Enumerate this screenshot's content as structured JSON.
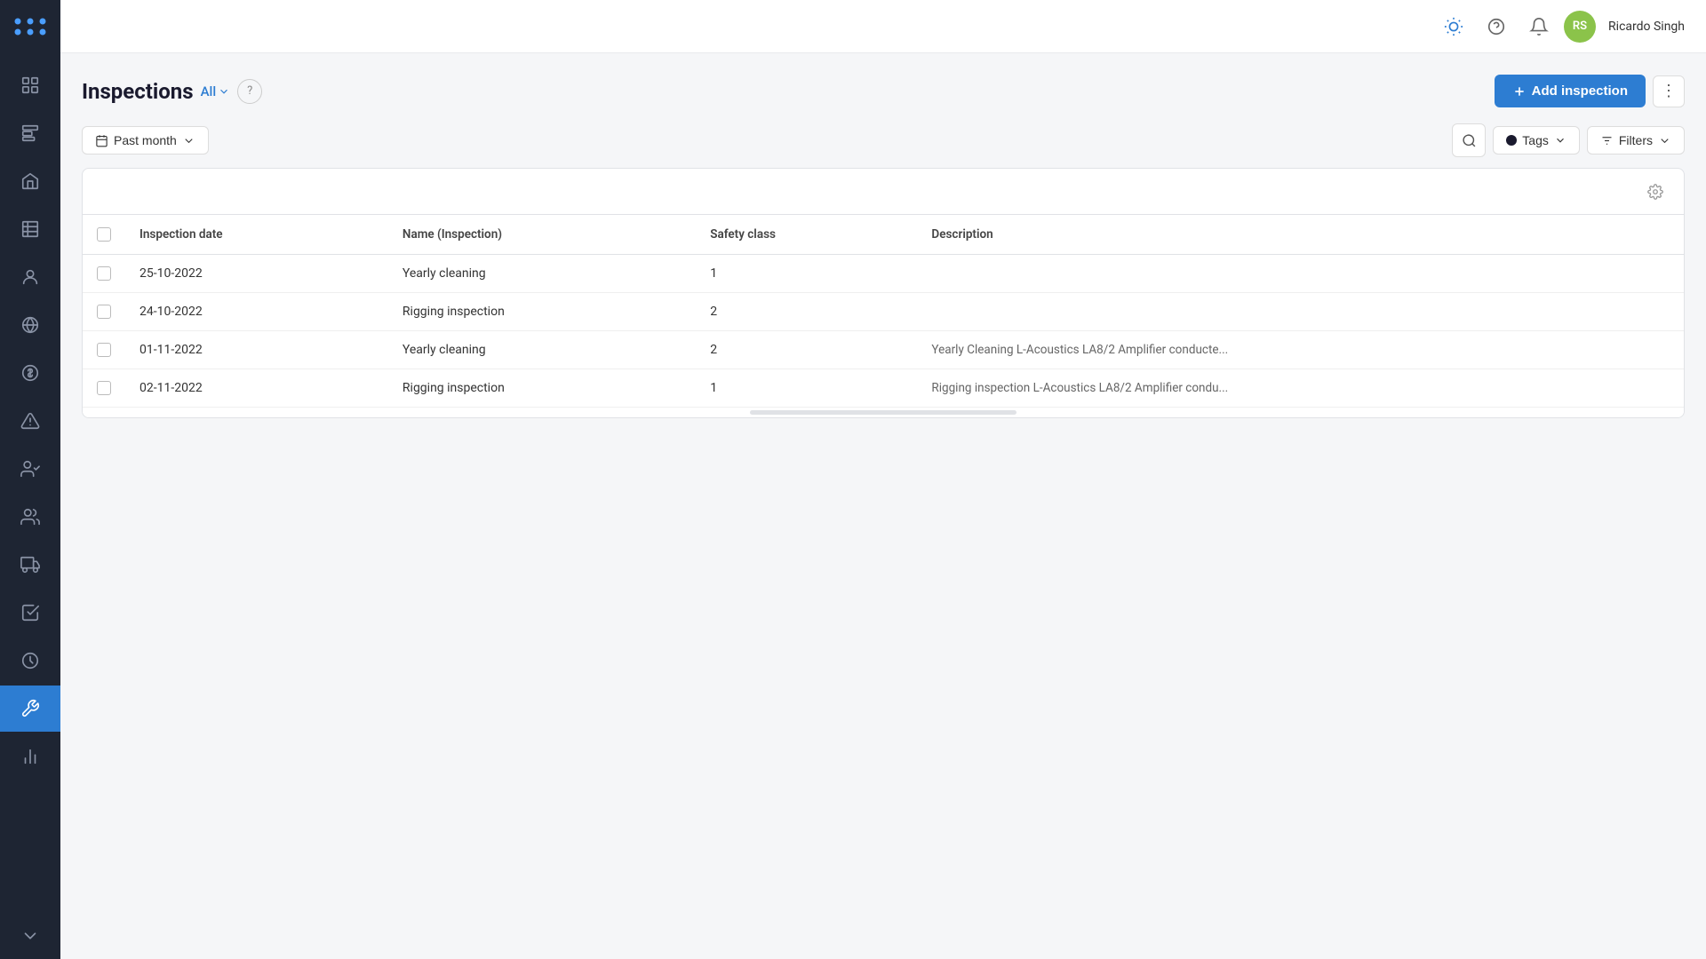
{
  "app": {
    "logo_text": ":::",
    "user": {
      "initials": "RS",
      "name": "Ricardo Singh",
      "avatar_color": "#8bc34a"
    }
  },
  "sidebar": {
    "items": [
      {
        "id": "dashboard",
        "icon": "grid"
      },
      {
        "id": "overview",
        "icon": "layout"
      },
      {
        "id": "assets",
        "icon": "home"
      },
      {
        "id": "table",
        "icon": "table"
      },
      {
        "id": "person",
        "icon": "person"
      },
      {
        "id": "globe",
        "icon": "globe"
      },
      {
        "id": "money",
        "icon": "dollar"
      },
      {
        "id": "alert",
        "icon": "alert-triangle"
      },
      {
        "id": "contact",
        "icon": "user-check"
      },
      {
        "id": "team",
        "icon": "users"
      },
      {
        "id": "truck",
        "icon": "truck"
      },
      {
        "id": "checklist",
        "icon": "check-square"
      },
      {
        "id": "clock",
        "icon": "clock"
      },
      {
        "id": "tools",
        "icon": "tool",
        "active": true
      },
      {
        "id": "analytics",
        "icon": "bar-chart"
      }
    ]
  },
  "topbar": {
    "theme_icon": "theme",
    "help_icon": "help-circle",
    "bell_icon": "bell"
  },
  "page": {
    "title": "Inspections",
    "filter_label": "All",
    "add_button_label": "Add inspection",
    "date_filter": "Past month",
    "tags_label": "Tags",
    "filters_label": "Filters"
  },
  "table": {
    "columns": [
      {
        "id": "checkbox",
        "label": ""
      },
      {
        "id": "inspection_date",
        "label": "Inspection date"
      },
      {
        "id": "name",
        "label": "Name (Inspection)"
      },
      {
        "id": "safety_class",
        "label": "Safety class"
      },
      {
        "id": "description",
        "label": "Description"
      }
    ],
    "rows": [
      {
        "id": 1,
        "inspection_date": "25-10-2022",
        "name": "Yearly cleaning",
        "safety_class": "1",
        "description": ""
      },
      {
        "id": 2,
        "inspection_date": "24-10-2022",
        "name": "Rigging inspection",
        "safety_class": "2",
        "description": ""
      },
      {
        "id": 3,
        "inspection_date": "01-11-2022",
        "name": "Yearly cleaning",
        "safety_class": "2",
        "description": "Yearly Cleaning L-Acoustics LA8/2 Amplifier conducte..."
      },
      {
        "id": 4,
        "inspection_date": "02-11-2022",
        "name": "Rigging inspection",
        "safety_class": "1",
        "description": "Rigging inspection L-Acoustics LA8/2 Amplifier condu..."
      }
    ]
  }
}
